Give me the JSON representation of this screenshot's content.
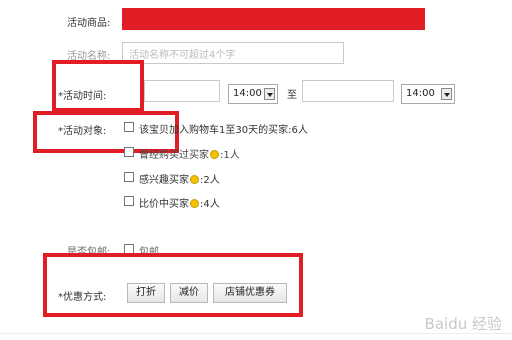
{
  "form": {
    "product_label": "活动商品:",
    "name_label": "活动名称:",
    "name_placeholder": "活动名称不可超过4个字",
    "time_label": "*活动时间:",
    "start_time": "14:00",
    "to_label": "至",
    "end_time": "14:00",
    "target_label": "*活动对象:",
    "targets": [
      {
        "text": "该宝贝加入购物车1至30天的买家:",
        "count": "6人"
      },
      {
        "text": "曾经购买过买家",
        "count": ":1人"
      },
      {
        "text": "感兴趣买家",
        "count": ":2人"
      },
      {
        "text": "比价中买家",
        "count": ":4人"
      }
    ],
    "shipping_label": "是否包邮:",
    "shipping_option": "包邮",
    "discount_label": "*优惠方式:",
    "discount_buttons": [
      "打折",
      "减价",
      "店铺优惠券"
    ]
  },
  "watermark": "Baidu 经验",
  "colors": {
    "highlight": "#e11d25",
    "accent_icon": "#f2c200"
  }
}
